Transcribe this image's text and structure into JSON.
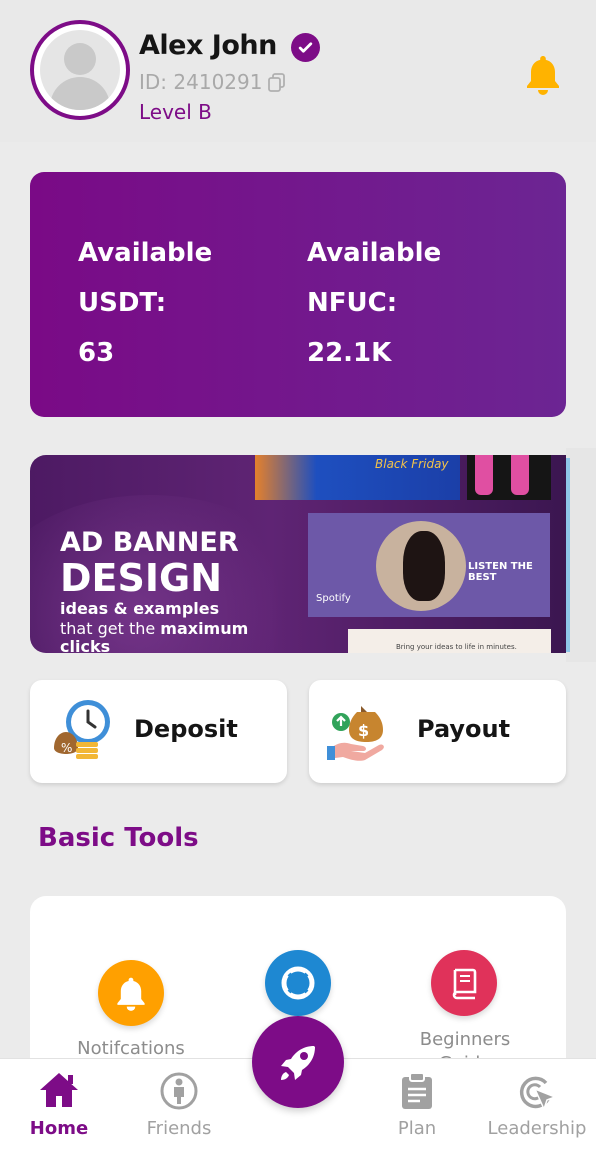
{
  "profile": {
    "name": "Alex John",
    "id_label": "ID: 2410291",
    "level": "Level B"
  },
  "balance": {
    "usdt": {
      "line1": "Available",
      "line2": "USDT:",
      "value": "63"
    },
    "nfuc": {
      "line1": "Available",
      "line2": "NFUC:",
      "value": "22.1K"
    }
  },
  "banner": {
    "line1": "AD BANNER",
    "line2": "DESIGN",
    "line3": "ideas & examples",
    "line4_pre": "that get the ",
    "line4_bold": "maximum",
    "line5": "clicks",
    "thumb_title": "Black Friday",
    "thumb_spot_tag": "LISTEN THE BEST",
    "thumb_spot_brand": "Spotify",
    "thumb_white_text": "Bring your ideas to life in minutes."
  },
  "actions": {
    "deposit": "Deposit",
    "payout": "Payout"
  },
  "basic_tools": {
    "title": "Basic Tools",
    "items": [
      {
        "label": "Notifcations",
        "icon": "bell-icon",
        "color": "#ffa000"
      },
      {
        "label": "",
        "icon": "lifebuoy-icon",
        "color": "#1e88d2"
      },
      {
        "label": "Beginners Guide",
        "icon": "book-icon",
        "color": "#e0325a"
      }
    ]
  },
  "nav": {
    "home": "Home",
    "friends": "Friends",
    "plan": "Plan",
    "leadership": "Leadership"
  },
  "colors": {
    "accent": "#7d0c87",
    "bell": "#ffb300",
    "background": "#ebebeb"
  }
}
